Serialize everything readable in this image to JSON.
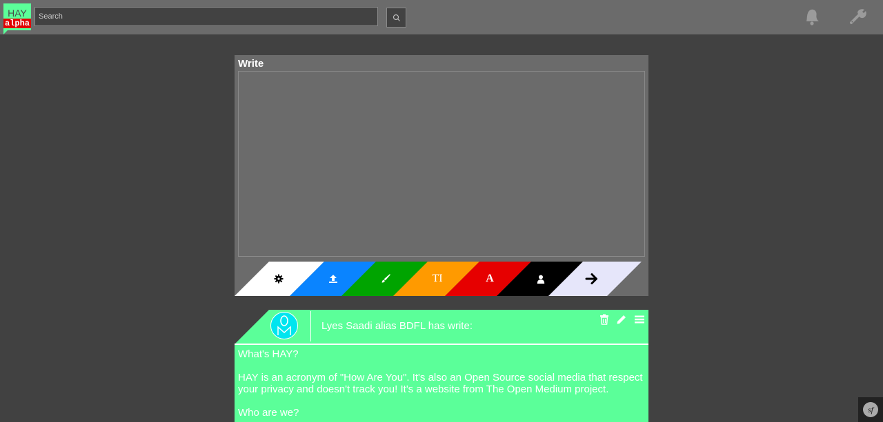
{
  "logo": {
    "top": "HAY",
    "badge": "alpha"
  },
  "search": {
    "placeholder": "Search",
    "value": "",
    "button_icon": "search-icon"
  },
  "header_icons": [
    "bell-icon",
    "wrench-icon"
  ],
  "composer": {
    "title": "Write",
    "text": "",
    "toolbar": [
      {
        "name": "settings",
        "icon": "gear-icon",
        "color": "#ffffff"
      },
      {
        "name": "upload",
        "icon": "upload-icon",
        "color": "#0a84ff"
      },
      {
        "name": "brush",
        "icon": "brush-icon",
        "color": "#00a400"
      },
      {
        "name": "text-style",
        "icon": "text-size-icon",
        "label": "TI",
        "color": "#ff9a00"
      },
      {
        "name": "font",
        "icon": "font-icon",
        "label": "A",
        "color": "#e60000"
      },
      {
        "name": "user",
        "icon": "user-icon",
        "color": "#000000"
      },
      {
        "name": "send",
        "icon": "arrow-right-icon",
        "color": "#e6e6fa"
      }
    ]
  },
  "post": {
    "author_line": "Lyes Saadi alias BDFL has write:",
    "actions": [
      "trash-icon",
      "pencil-icon",
      "menu-icon"
    ],
    "body": [
      "What's HAY?",
      "HAY is an acronym of \"How Are You\". It's also an Open Source social media that respect your privacy and doesn't track you! It's a website from The Open Medium project.",
      "Who are we?"
    ],
    "accent": "#5bff99"
  },
  "debug_badge": {
    "icon": "symfony-icon"
  }
}
